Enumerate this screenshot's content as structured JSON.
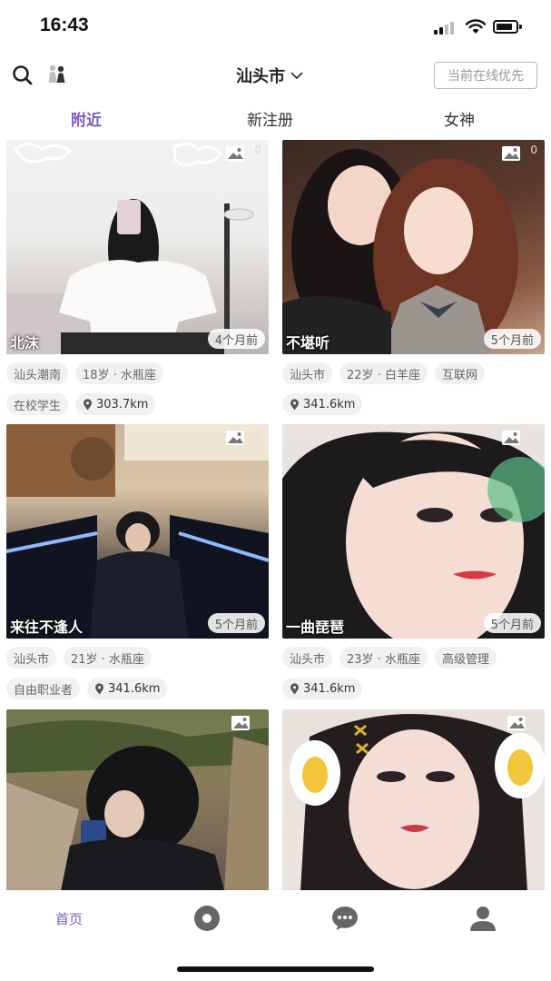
{
  "status_bar": {
    "time": "16:43"
  },
  "header": {
    "city": "汕头市",
    "priority_button": "当前在线优先"
  },
  "tabs": [
    {
      "label": "附近",
      "active": true
    },
    {
      "label": "新注册",
      "active": false
    },
    {
      "label": "女神",
      "active": false
    }
  ],
  "cards": [
    {
      "nickname": "北沫",
      "time_ago": "4个月前",
      "photo_count": "0",
      "tags_row1": [
        "汕头潮南",
        "18岁 · 水瓶座"
      ],
      "tag_row2_text": "在校学生",
      "distance": "303.7km"
    },
    {
      "nickname": "不堪听",
      "time_ago": "5个月前",
      "photo_count": "0",
      "tags_row1": [
        "汕头市",
        "22岁 · 白羊座",
        "互联网"
      ],
      "tag_row2_text": "",
      "distance": "341.6km"
    },
    {
      "nickname": "来往不逢人",
      "time_ago": "5个月前",
      "photo_count": "0",
      "tags_row1": [
        "汕头市",
        "21岁 · 水瓶座"
      ],
      "tag_row2_text": "自由职业者",
      "distance": "341.6km"
    },
    {
      "nickname": "一曲琵琶",
      "time_ago": "5个月前",
      "photo_count": "0",
      "tags_row1": [
        "汕头市",
        "23岁 · 水瓶座",
        "高级管理"
      ],
      "tag_row2_text": "",
      "distance": "341.6km"
    }
  ],
  "bottom_nav": {
    "home_label": "首页",
    "active_color": "#7a5ac8"
  },
  "icons": [
    "search-icon",
    "people-filter-icon",
    "chevron-down-icon",
    "image-icon",
    "location-pin-icon",
    "discover-icon",
    "chat-icon",
    "profile-icon"
  ]
}
